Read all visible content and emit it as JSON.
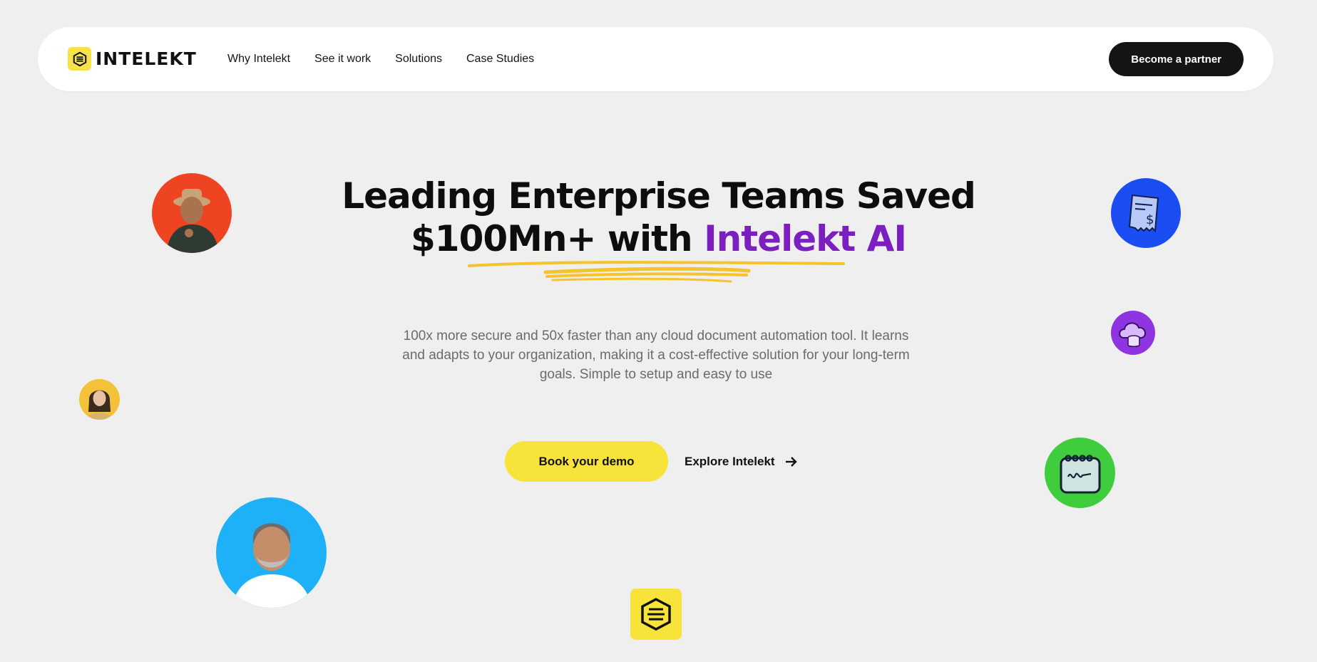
{
  "brand": {
    "name": "INTELEKT",
    "color_yellow": "#f7e348"
  },
  "nav": {
    "links": [
      "Why Intelekt",
      "See it work",
      "Solutions",
      "Case Studies"
    ],
    "cta_label": "Become a partner"
  },
  "hero": {
    "headline_line1": "Leading Enterprise Teams Saved",
    "headline_line2_prefix": "$100Mn+ with ",
    "headline_accent": "Intelekt AI",
    "accent_color": "#7c1fc1",
    "subtext": "100x more secure and 50x faster than any cloud document automation tool. It learns and adapts to your organization, making it a cost-effective solution for your long-term goals. Simple to setup and easy to use",
    "primary_cta": "Book your demo",
    "secondary_cta": "Explore Intelekt"
  },
  "decor": {
    "avatars": [
      "person-hat-avatar",
      "woman-avatar",
      "smiling-man-avatar"
    ],
    "icons": [
      "receipt-dollar-icon",
      "cloud-database-icon",
      "signed-notepad-icon"
    ],
    "colors": {
      "orange": "#ee4422",
      "blue": "#1b4ef2",
      "purple": "#8e34e0",
      "green": "#3fcd3d",
      "sky": "#1fb1f7",
      "yellow": "#f8e33a"
    }
  }
}
